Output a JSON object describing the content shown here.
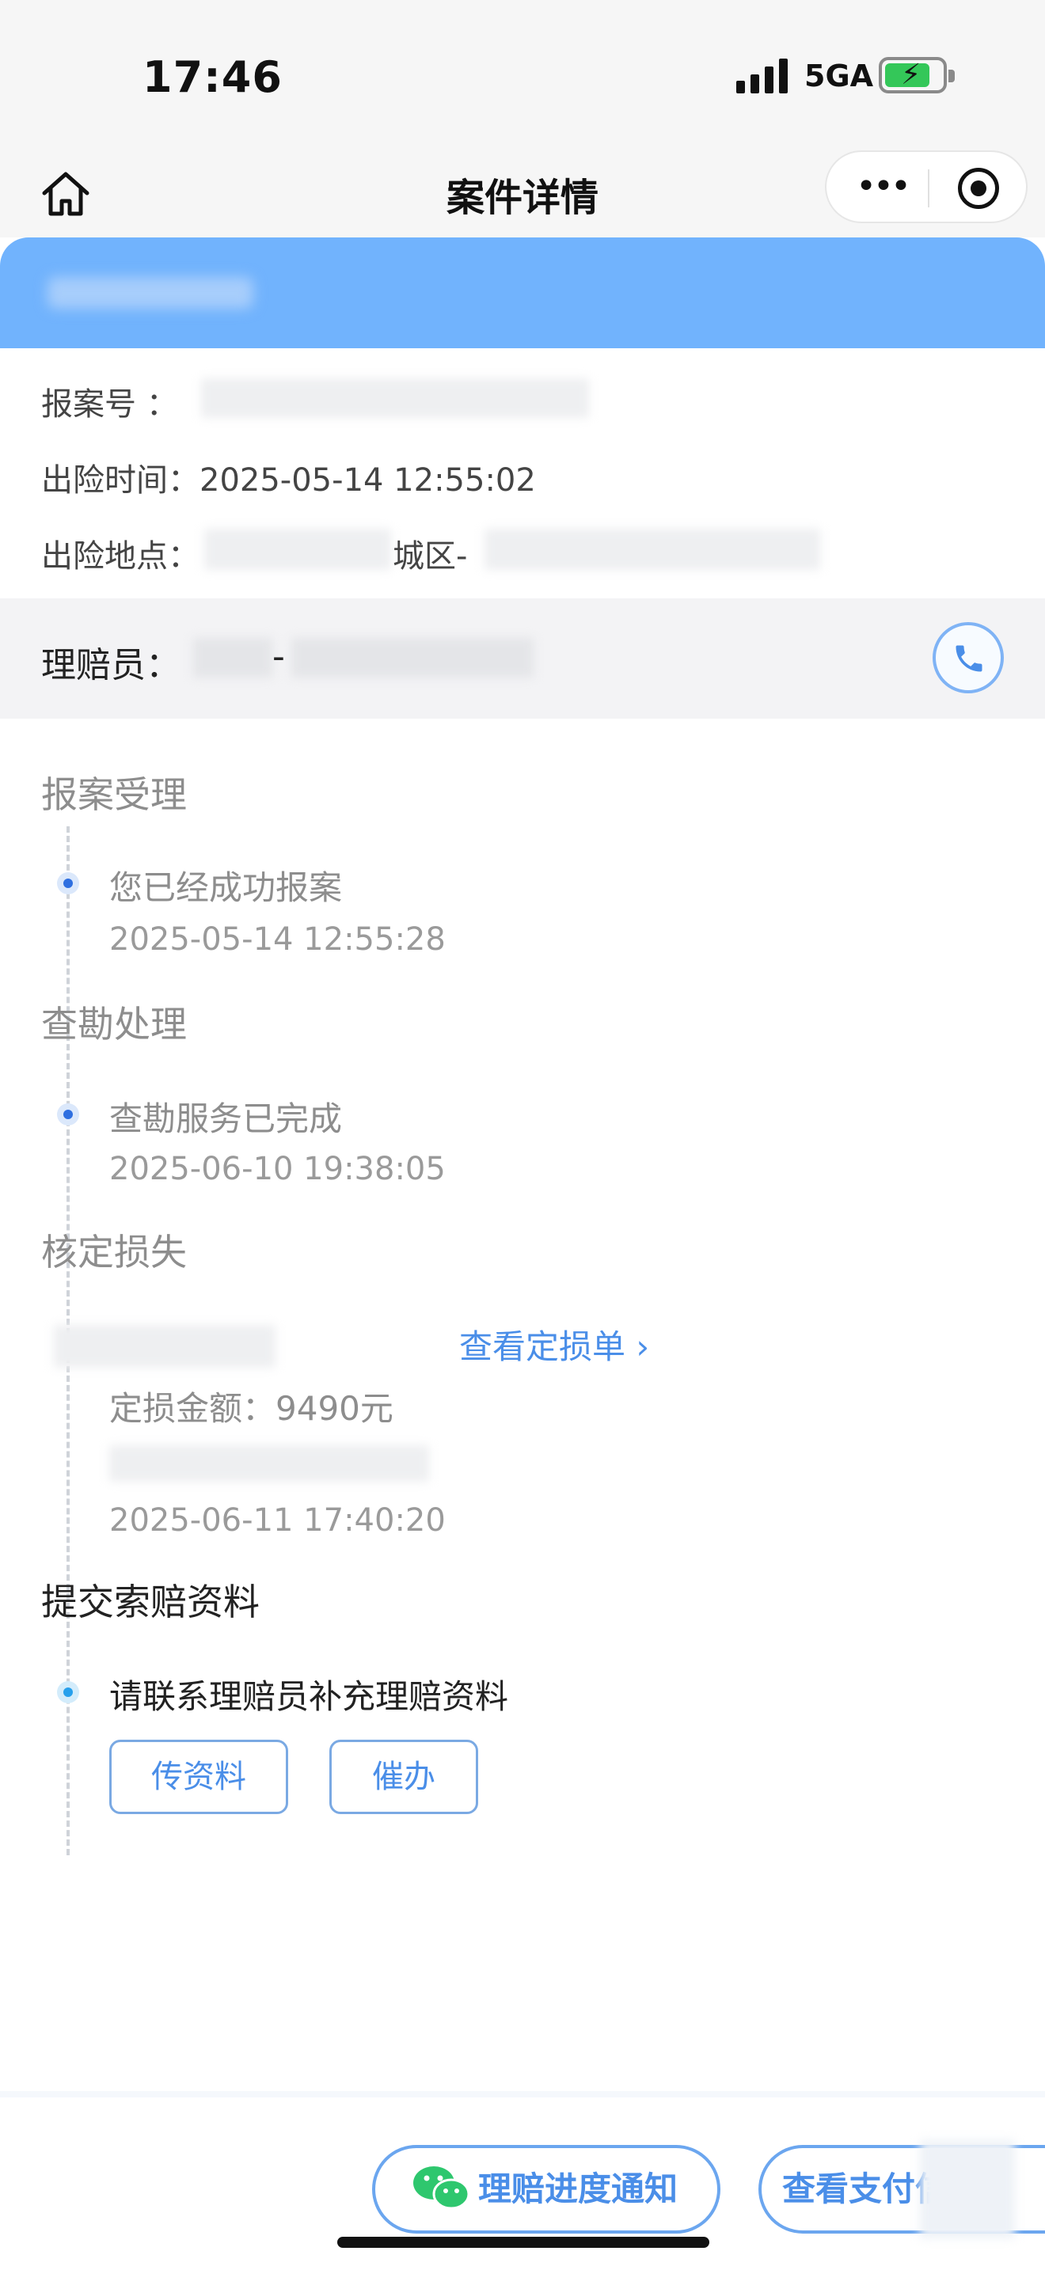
{
  "status_bar": {
    "time": "17:46",
    "network": "5GA"
  },
  "nav": {
    "title": "案件详情",
    "more_label": "•••"
  },
  "case_info": {
    "report_no_label": "报案号 ：",
    "accident_time_label": "出险时间：",
    "accident_time_value": "2025-05-14 12:55:02",
    "accident_place_label": "出险地点：",
    "accident_place_fragment": "城区-"
  },
  "adjuster": {
    "label": "理赔员：",
    "separator": "-"
  },
  "timeline": [
    {
      "stage": "报案受理",
      "text": "您已经成功报案",
      "time": "2025-05-14 12:55:28"
    },
    {
      "stage": "查勘处理",
      "text": "查勘服务已完成",
      "time": "2025-06-10 19:38:05"
    },
    {
      "stage": "核定损失",
      "link": "查看定损单 ›",
      "amount": "定损金额：9490元",
      "time": "2025-06-11 17:40:20"
    },
    {
      "stage": "提交索赔资料",
      "text": "请联系理赔员补充理赔资料",
      "upload_btn": "传资料",
      "urge_btn": "催办"
    }
  ],
  "bottom": {
    "notify_btn": "理赔进度通知",
    "payment_btn": "查看支付信"
  },
  "colors": {
    "accent": "#4a8ee8",
    "header_blue": "#71b3fd",
    "wechat_green": "#2ec76e"
  }
}
